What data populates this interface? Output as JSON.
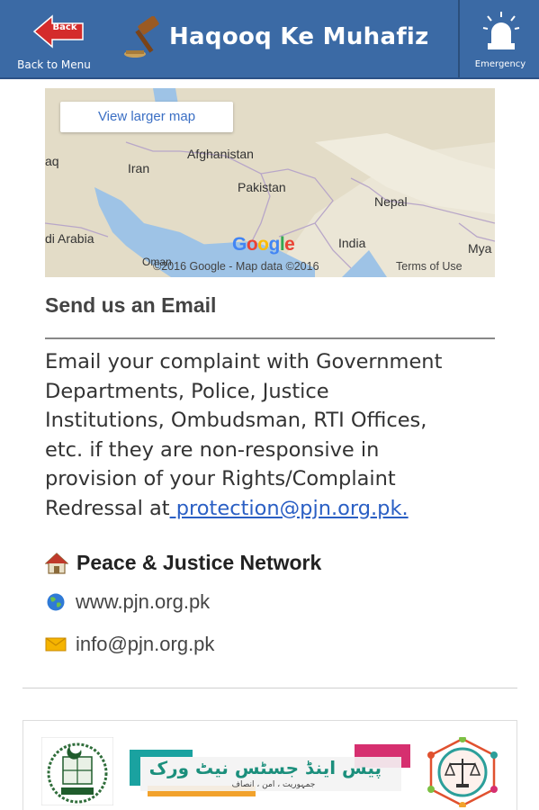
{
  "header": {
    "back_badge": "Back",
    "back_label": "Back to Menu",
    "title": "Haqooq Ke Muhafiz",
    "emergency_label": "Emergency",
    "bg_color": "#3b6aa5"
  },
  "map": {
    "view_larger": "View larger map",
    "labels": {
      "iraq": "aq",
      "iran": "Iran",
      "afghanistan": "Afghanistan",
      "pakistan": "Pakistan",
      "nepal": "Nepal",
      "arabia": "di Arabia",
      "india": "India",
      "myanmar": "Mya",
      "oman": "Oman"
    },
    "google": [
      "G",
      "o",
      "o",
      "g",
      "l",
      "e"
    ],
    "copyright": "©2016 Google - Map data ©2016",
    "terms": "Terms of Use"
  },
  "email_section": {
    "title": "Send us an Email",
    "lines": [
      "Email your complaint with Government",
      "Departments, Police, Justice",
      "Institutions, Ombudsman, RTI Offices,",
      "etc. if they are non-responsive in",
      "provision of your Rights/Complaint"
    ],
    "last_line_prefix": "Redressal at",
    "email_link": " protection@pjn.org.pk."
  },
  "org": {
    "name": "Peace & Justice Network",
    "website": "www.pjn.org.pk",
    "email": "info@pjn.org.pk"
  },
  "logos": {
    "center_urdu": "پیس اینڈ جسٹس نیٹ ورک",
    "center_sub": "جمہوریت ، امن ، انصاف"
  },
  "icons": {
    "back": "back-arrow-icon",
    "gavel": "gavel-icon",
    "siren": "siren-icon",
    "home": "home-icon",
    "globe": "globe-icon",
    "mail": "mail-icon"
  }
}
